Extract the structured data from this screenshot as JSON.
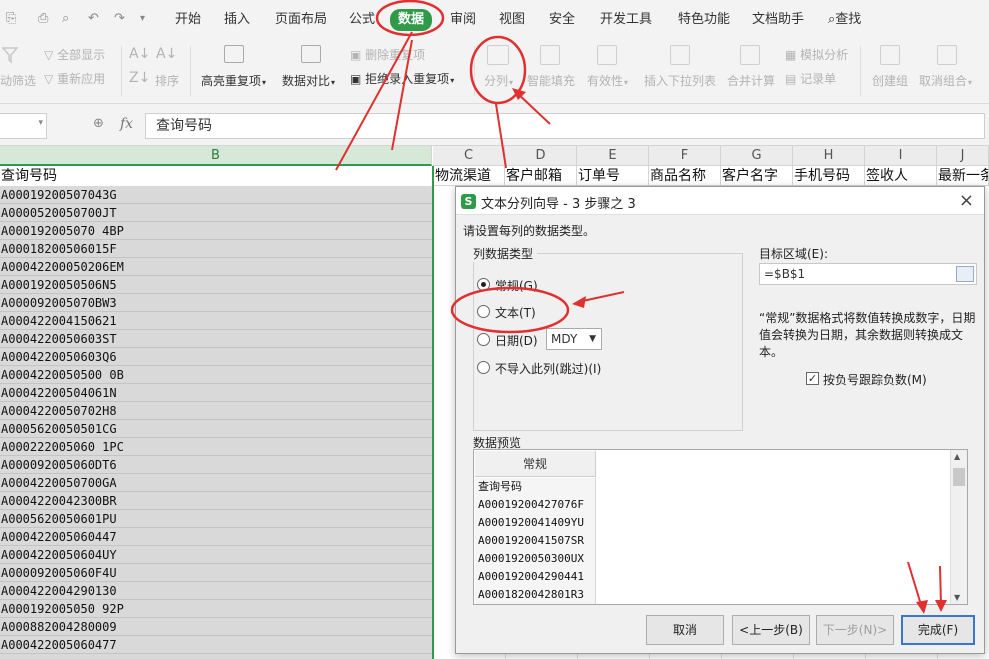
{
  "menubar": {
    "items": [
      "开始",
      "插入",
      "页面布局",
      "公式",
      "数据",
      "审阅",
      "视图",
      "安全",
      "开发工具",
      "特色功能",
      "文档助手",
      "查找"
    ]
  },
  "ribbon": {
    "auto_filter": "动筛选",
    "show_all": "全部显示",
    "reapply": "重新应用",
    "sort": "排序",
    "highlight_dup": "高亮重复项",
    "data_compare": "数据对比",
    "delete_dup": "删除重复项",
    "reject_dup": "拒绝录入重复项",
    "split": "分列",
    "smart_fill": "智能填充",
    "validity": "有效性",
    "insert_dropdown": "插入下拉列表",
    "merge_calc": "合并计算",
    "simulate": "模拟分析",
    "record": "记录单",
    "create_group": "创建组",
    "ungroup": "取消组合"
  },
  "formula_bar": {
    "fx": "fx",
    "value": "查询号码"
  },
  "columns": {
    "B": "B",
    "C": "C",
    "D": "D",
    "E": "E",
    "F": "F",
    "G": "G",
    "H": "H",
    "I": "I",
    "J": "J"
  },
  "header_row": {
    "B": "查询号码",
    "C": "物流渠道",
    "D": "客户邮箱",
    "E": "订单号",
    "F": "商品名称",
    "G": "客户名字",
    "H": "手机号码",
    "I": "签收人",
    "J": "最新一条"
  },
  "column_b": [
    "A00019200507043G",
    "A0000520050700JT",
    "A000192005070 4BP",
    "A00018200506015F",
    "A00042200050206EM",
    "A0001920050506N5",
    "A000092005070BW3",
    "A000422004150621",
    "A0004220050603ST",
    "A0004220050603Q6",
    "A0004220050500 0B",
    "A00042200504061N",
    "A0004220050702H8",
    "A0005620050501CG",
    "A000222005060 1PC",
    "A000092005060DT6",
    "A0004220050700GA",
    "A0004220042300BR",
    "A0005620050601PU",
    "A000422005060447",
    "A0004220050604UY",
    "A000092005060F4U",
    "A000422004290130",
    "A000192005050 92P",
    "A000882004280009",
    "A000422005060477"
  ],
  "dialog": {
    "title": "文本分列向导 - 3 步骤之 3",
    "instruction": "请设置每列的数据类型。",
    "group_label": "列数据类型",
    "radio_general": "常规(G)",
    "radio_text": "文本(T)",
    "radio_date": "日期(D)",
    "date_format": "MDY",
    "radio_skip": "不导入此列(跳过)(I)",
    "target_label": "目标区域(E):",
    "target_value": "=$B$1",
    "description": "“常规”数据格式将数值转换成数字，日期值会转换为日期，其余数据则转换成文本。",
    "checkbox_label": "按负号跟踪负数(M)",
    "checkbox_mark": "✓",
    "preview_label": "数据预览",
    "preview_header": "常规",
    "preview_rows": [
      "查询号码",
      "A00019200427076F",
      "A0001920041409YU",
      "A0001920041507SR",
      "A0001920050300UX",
      "A000192004290441",
      "A0001820042801R3"
    ],
    "btn_cancel": "取消",
    "btn_prev": "<上一步(B)",
    "btn_next": "下一步(N)>",
    "btn_finish": "完成(F)"
  }
}
